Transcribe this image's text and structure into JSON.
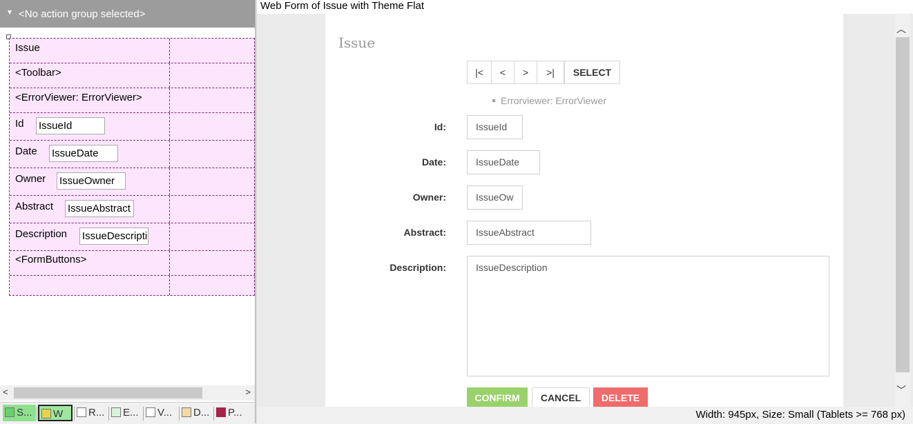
{
  "left_panel": {
    "action_group_label": "<No action group selected>",
    "grid_rows": [
      {
        "label": "Issue"
      },
      {
        "label": "<Toolbar>"
      },
      {
        "label": "<ErrorViewer: ErrorViewer>"
      },
      {
        "label": "Id",
        "field": "IssueId"
      },
      {
        "label": "Date",
        "field": "IssueDate"
      },
      {
        "label": "Owner",
        "field": "IssueOwner"
      },
      {
        "label": "Abstract",
        "field": "IssueAbstract"
      },
      {
        "label": "Description",
        "field": "IssueDescriptio"
      },
      {
        "label": "<FormButtons>"
      },
      {
        "label": ""
      }
    ],
    "bottom_tabs": [
      {
        "label": "S...",
        "icon": "structure-icon"
      },
      {
        "label": "W",
        "icon": "webform-icon"
      },
      {
        "label": "R...",
        "icon": "rules-icon"
      },
      {
        "label": "E...",
        "icon": "events-icon"
      },
      {
        "label": "V...",
        "icon": "variables-icon"
      },
      {
        "label": "D...",
        "icon": "documentation-icon"
      },
      {
        "label": "P...",
        "icon": "patterns-icon"
      }
    ]
  },
  "preview": {
    "window_title": "Web Form of Issue with Theme Flat",
    "form_title": "Issue",
    "toolbar": {
      "first": "|<",
      "prev": "<",
      "next": ">",
      "last": ">|",
      "select": "SELECT"
    },
    "error_viewer_text": "Errorviewer: ErrorViewer",
    "fields": [
      {
        "label": "Id:",
        "value": "IssueId"
      },
      {
        "label": "Date:",
        "value": "IssueDate"
      },
      {
        "label": "Owner:",
        "value": "IssueOw"
      },
      {
        "label": "Abstract:",
        "value": "IssueAbstract"
      },
      {
        "label": "Description:",
        "value": "IssueDescription"
      }
    ],
    "buttons": {
      "confirm": "CONFIRM",
      "cancel": "CANCEL",
      "delete": "DELETE"
    },
    "status_text": "Width: 945px, Size: Small (Tablets >= 768 px)"
  },
  "colors": {
    "confirm": "#99d16b",
    "delete": "#f06b6b",
    "grid_bg": "#fde6fd",
    "action_bar": "#9c9c9c"
  }
}
